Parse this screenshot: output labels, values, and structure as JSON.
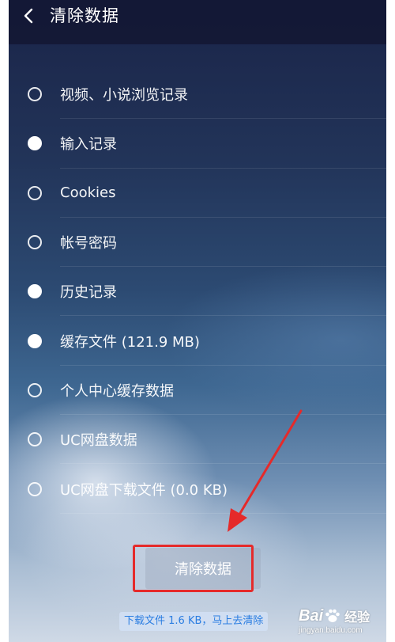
{
  "header": {
    "title": "清除数据"
  },
  "options": [
    {
      "label": "视频、小说浏览记录",
      "checked": false
    },
    {
      "label": "输入记录",
      "checked": true
    },
    {
      "label": "Cookies",
      "checked": false
    },
    {
      "label": "帐号密码",
      "checked": false
    },
    {
      "label": "历史记录",
      "checked": true
    },
    {
      "label": "缓存文件 (121.9 MB)",
      "checked": true
    },
    {
      "label": "个人中心缓存数据",
      "checked": false
    },
    {
      "label": "UC网盘数据",
      "checked": false
    },
    {
      "label": "UC网盘下载文件 (0.0 KB)",
      "checked": false
    }
  ],
  "actions": {
    "clear_label": "清除数据"
  },
  "toast": {
    "text": "下载文件 1.6 KB，马上去清除"
  },
  "watermark": {
    "brand_left": "Bai",
    "brand_right": "经验",
    "url": "jingyan.baidu.com"
  },
  "colors": {
    "annotation_red": "#e52a2a",
    "toast_text": "#2a7de1"
  }
}
